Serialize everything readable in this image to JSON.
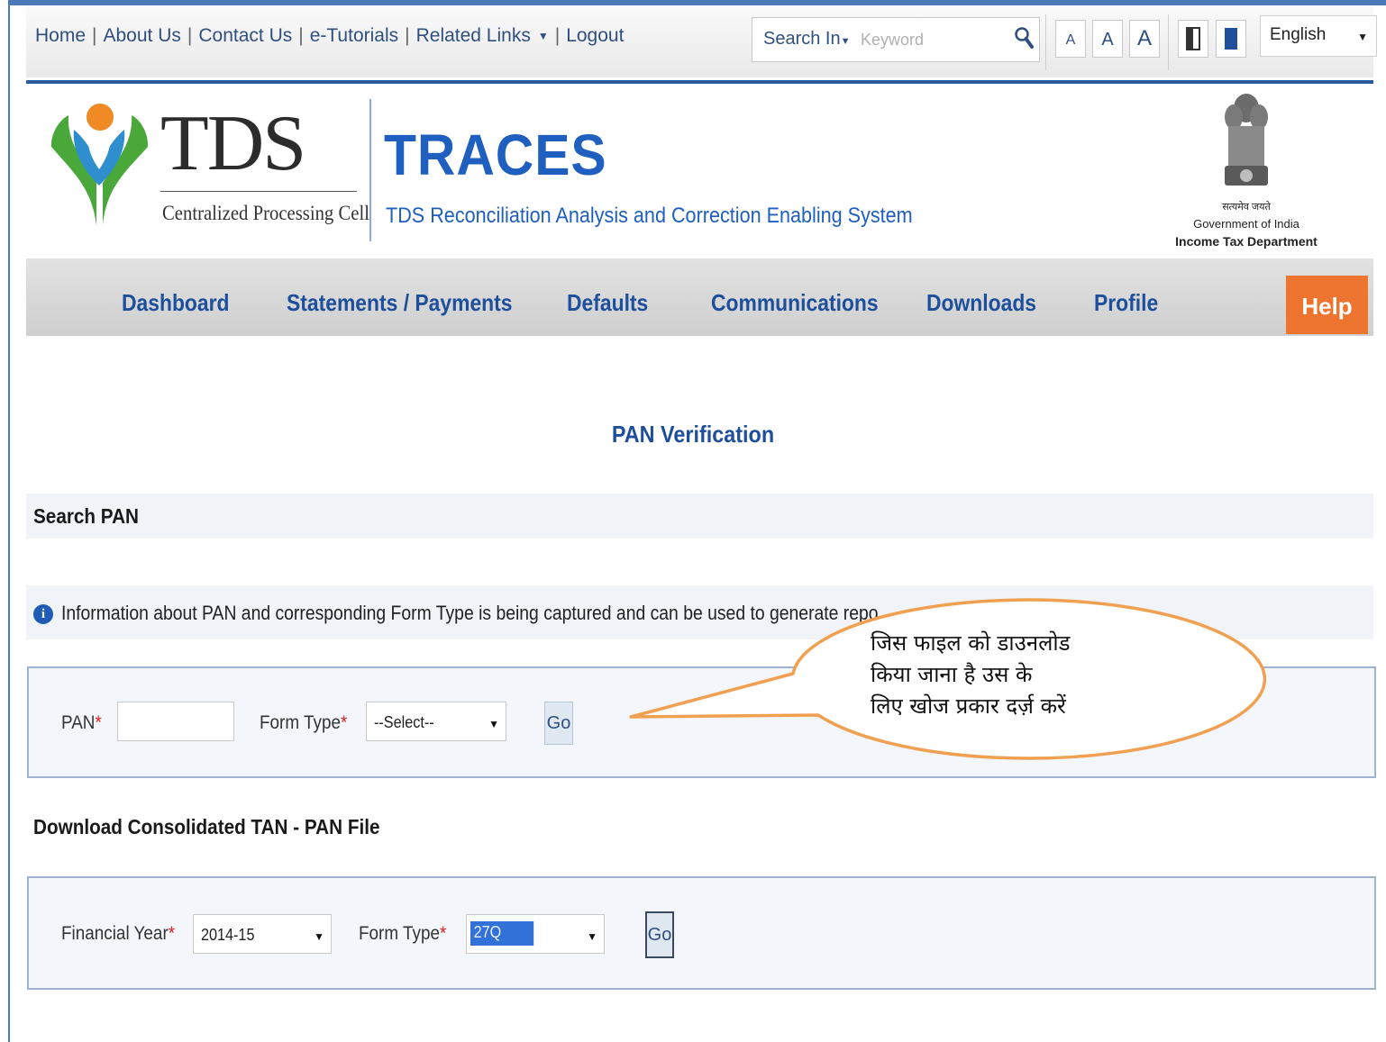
{
  "topbar": {
    "links": [
      "Home",
      "About Us",
      "Contact Us",
      "e-Tutorials",
      "Related Links",
      "Logout"
    ],
    "search_in_label": "Search In",
    "keyword_placeholder": "Keyword",
    "font_sizes": [
      "A",
      "A",
      "A"
    ],
    "language": "English"
  },
  "header": {
    "logo_text": "TDS",
    "logo_subtitle": "Centralized Processing Cell",
    "app_name": "TRACES",
    "app_fullname": "TDS Reconciliation Analysis and Correction Enabling System",
    "gov_motto": "सत्यमेव जयते",
    "gov_name": "Government of India",
    "gov_dept": "Income Tax Department"
  },
  "nav": {
    "items": [
      "Dashboard",
      "Statements / Payments",
      "Defaults",
      "Communications",
      "Downloads",
      "Profile"
    ],
    "help": "Help"
  },
  "page": {
    "title": "PAN Verification",
    "search_section": "Search PAN",
    "info_text": "Information about PAN and corresponding Form Type is being captured and can be used to generate repo",
    "search_form": {
      "pan_label": "PAN",
      "pan_value": "",
      "form_type_label": "Form Type",
      "form_type_value": "--Select--",
      "go": "Go"
    },
    "download_section": "Download Consolidated TAN - PAN File",
    "download_form": {
      "fy_label": "Financial Year",
      "fy_value": "2014-15",
      "form_type_label": "Form Type",
      "form_type_value": "27Q",
      "go": "Go"
    },
    "required_mark": "*"
  },
  "callout": {
    "lines": [
      "जिस फाइल को डाउनलोड",
      "किया जाना है उस के",
      "लिए खोज प्रकार दर्ज़ करें"
    ]
  },
  "colors": {
    "brand_blue": "#1e5fbf",
    "nav_text": "#1d4f9c",
    "help_orange": "#ee7530",
    "callout_border": "#f0a050"
  }
}
